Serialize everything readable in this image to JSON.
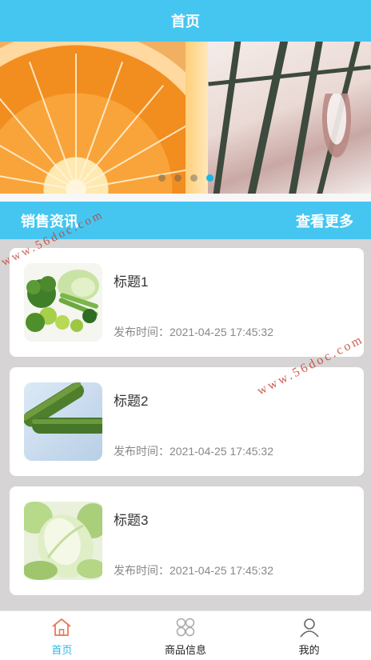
{
  "header": {
    "title": "首页"
  },
  "banner": {
    "active_index": 3,
    "dots": 4
  },
  "section": {
    "title": "销售资讯",
    "more_label": "查看更多"
  },
  "news": [
    {
      "title": "标题1",
      "time": "发布时间：2021-04-25 17:45:32",
      "thumb": "mixed-vegetables"
    },
    {
      "title": "标题2",
      "time": "发布时间：2021-04-25 17:45:32",
      "thumb": "cucumbers"
    },
    {
      "title": "标题3",
      "time": "发布时间：2021-04-25 17:45:32",
      "thumb": "chinese-cabbage"
    }
  ],
  "tabbar": {
    "items": [
      {
        "label": "首页",
        "icon": "home-icon",
        "active": true
      },
      {
        "label": "商品信息",
        "icon": "grid-icon",
        "active": false
      },
      {
        "label": "我的",
        "icon": "user-icon",
        "active": false
      }
    ]
  },
  "watermark": "www.56doc.com",
  "colors": {
    "primary": "#45c6f1",
    "active_tab": "#2fb6e7",
    "background": "#d6d4d4"
  }
}
